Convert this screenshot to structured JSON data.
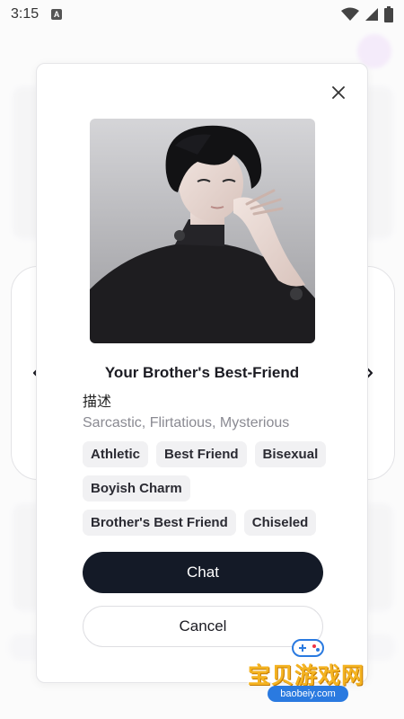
{
  "status_bar": {
    "time": "3:15",
    "notification_badge": "A"
  },
  "modal": {
    "character_name": "Your Brother's Best-Friend",
    "description_label": "描述",
    "traits": "Sarcastic, Flirtatious, Mysterious",
    "tags": [
      "Athletic",
      "Best Friend",
      "Bisexual",
      "Boyish Charm",
      "Brother's Best Friend",
      "Chiseled"
    ],
    "chat_label": "Chat",
    "cancel_label": "Cancel"
  },
  "watermark": {
    "title": "宝贝游戏网",
    "url": "baobeiy.com"
  },
  "colors": {
    "primary_button": "#141a27",
    "tag_bg": "#f1f1f3",
    "trait_text": "#8a8a92"
  }
}
